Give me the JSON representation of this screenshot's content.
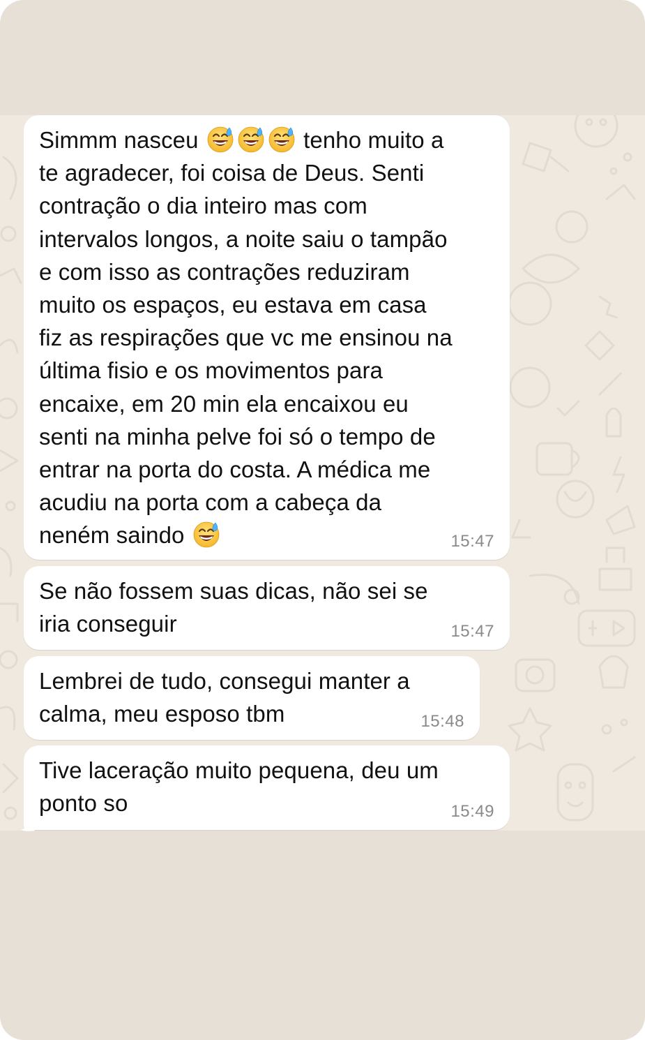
{
  "messages": [
    {
      "parts": [
        "Simmm nasceu ",
        "grinning-sweat-emoji",
        "grinning-sweat-emoji",
        "grinning-sweat-emoji",
        " tenho muito a\nte agradecer, foi coisa de Deus. Senti\ncontração o dia inteiro mas com\nintervalos longos, a noite saiu o tampão\ne com isso as contrações reduziram\nmuito os espaços, eu estava em casa\nfiz as respirações que vc me ensinou na\núltima fisio e os movimentos para\nencaixe, em 20 min ela encaixou eu\nsenti na minha pelve foi só o tempo de\nentrar na porta do costa. A médica me\nacudiu na porta com a cabeça da\nneném saindo ",
        "grinning-sweat-emoji"
      ],
      "time": "15:47"
    },
    {
      "text": "Se não fossem suas dicas, não sei se\niria conseguir",
      "time": "15:47"
    },
    {
      "text": "Lembrei de tudo, consegui manter a\ncalma, meu esposo tbm",
      "time": "15:48"
    },
    {
      "text": "Tive laceração muito pequena, deu um\nponto so",
      "time": "15:49"
    }
  ],
  "colors": {
    "frame_background": "#e7e0d6",
    "chat_background": "#efe9e0",
    "bubble_background": "#ffffff",
    "text": "#111111",
    "timestamp": "#8a8a8a"
  }
}
